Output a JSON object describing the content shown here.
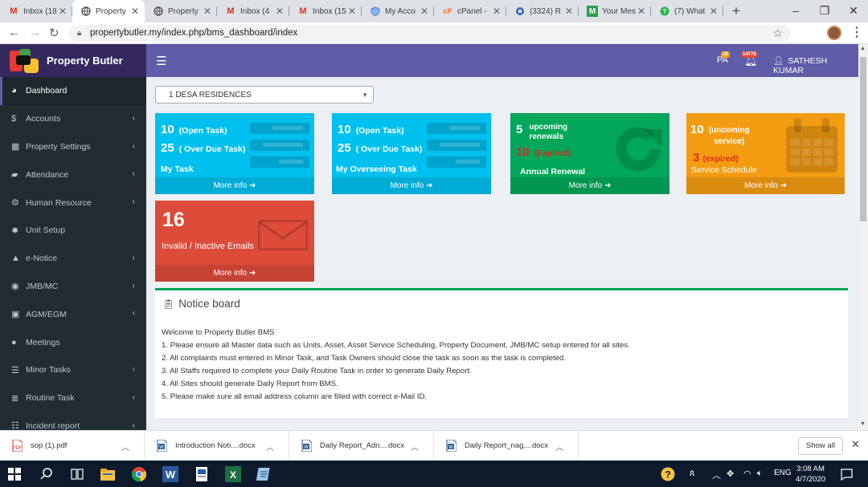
{
  "browser": {
    "tabs": [
      {
        "label": "Inbox (18",
        "icon": "gmail-icon"
      },
      {
        "label": "Property",
        "icon": "globe-icon",
        "active": true
      },
      {
        "label": "Property",
        "icon": "globe-icon"
      },
      {
        "label": "Inbox (4",
        "icon": "gmail-icon"
      },
      {
        "label": "Inbox (15",
        "icon": "gmail-icon"
      },
      {
        "label": "My Acco",
        "icon": "shield-icon"
      },
      {
        "label": "cPanel -",
        "icon": "cpanel-icon"
      },
      {
        "label": "(3324) R",
        "icon": "disc-icon"
      },
      {
        "label": "Your Mes",
        "icon": "m-icon"
      },
      {
        "label": "(7) What",
        "icon": "whatsapp-icon"
      }
    ],
    "new_tab": "+",
    "url": "propertybutler.my/index.php/bms_dashboard/index"
  },
  "header": {
    "brand": "Property Butler",
    "pa_label": "PA",
    "pa_badge": "16",
    "bell_badge": "14778",
    "user_name": "SATHESH KUMAR",
    "colors": {
      "header": "#605ca8",
      "logo_bg": "#35285f",
      "sidebar": "#222d32"
    }
  },
  "sidebar": {
    "items": [
      {
        "label": "Dashboard",
        "icon": "dashboard-icon",
        "active": true
      },
      {
        "label": "Accounts",
        "icon": "dollar-icon",
        "chevron": true
      },
      {
        "label": "Property Settings",
        "icon": "building-icon",
        "chevron": true
      },
      {
        "label": "Attendance",
        "icon": "book-icon",
        "chevron": true
      },
      {
        "label": "Human Resource",
        "icon": "gears-icon",
        "chevron": true
      },
      {
        "label": "Unit Setup",
        "icon": "gear-icon",
        "chevron": false
      },
      {
        "label": "e-Notice",
        "icon": "warning-icon",
        "chevron": true
      },
      {
        "label": "JMB/MC",
        "icon": "user-circle-icon",
        "chevron": true
      },
      {
        "label": "AGM/EGM",
        "icon": "id-card-icon",
        "chevron": true
      },
      {
        "label": "Meetings",
        "icon": "comment-icon",
        "chevron": false
      },
      {
        "label": "Minor Tasks",
        "icon": "tasks-icon",
        "chevron": true
      },
      {
        "label": "Routine Task",
        "icon": "list-icon",
        "chevron": true
      },
      {
        "label": "Incident report",
        "icon": "report-icon",
        "chevron": true
      }
    ]
  },
  "main": {
    "property_select": "1 DESA RESIDENCES",
    "more_info": "More info",
    "boxes": {
      "my_task": {
        "open_count": "10",
        "open_label": "(Open Task)",
        "overdue_count": "25",
        "overdue_label": "( Over Due Task)",
        "title": "My Task",
        "color": "#00c0ef"
      },
      "overseeing": {
        "open_count": "10",
        "open_label": "(Open Task)",
        "overdue_count": "25",
        "overdue_label": "( Over Due Task)",
        "title": "My Overseeing Task",
        "color": "#00c0ef"
      },
      "renewal": {
        "count": "5",
        "label_1": "upcoming",
        "label_2": "renewals",
        "expired_count": "10",
        "expired_label": "(Expired)",
        "title": "Annual Renewal",
        "color": "#00a65a"
      },
      "service": {
        "count": "10",
        "label_1": "(uncoming",
        "label_2": "service)",
        "expired_count": "3",
        "expired_label": "(expired)",
        "title": "Service Schedule",
        "color": "#f39c12"
      },
      "emails": {
        "count": "16",
        "title": "Invalid / Inactive Emails",
        "color": "#dd4b39"
      }
    },
    "notice": {
      "title": "Notice board",
      "lines": [
        "Welcome to Property Butler BMS",
        "1. Please ensure all Master data such as Units, Asset, Asset Service Scheduling, Property Document, JMB/MC setup entered for all sites.",
        "2. All complaints must entered in Minor Task, and Task Owners should close the task as soon as the task is completed.",
        "3. All Staffs required to complete your Daily Routine Task in order to generate Daily Report.",
        "4. All Sites should generate Daily Report from BMS.",
        "5. Please make sure all email address column are filled with correct e-Mail ID."
      ]
    }
  },
  "downloads": {
    "items": [
      {
        "name": "sop (1).pdf",
        "icon": "pdf-icon"
      },
      {
        "name": "Introduction Noti....docx",
        "icon": "word-doc-icon"
      },
      {
        "name": "Daily Report_Adn....docx",
        "icon": "word-doc-icon"
      },
      {
        "name": "Daily Report_nag....docx",
        "icon": "word-doc-icon"
      }
    ],
    "show_all": "Show all"
  },
  "taskbar": {
    "lang": "ENG",
    "time": "3:08 AM",
    "date": "4/7/2020"
  }
}
